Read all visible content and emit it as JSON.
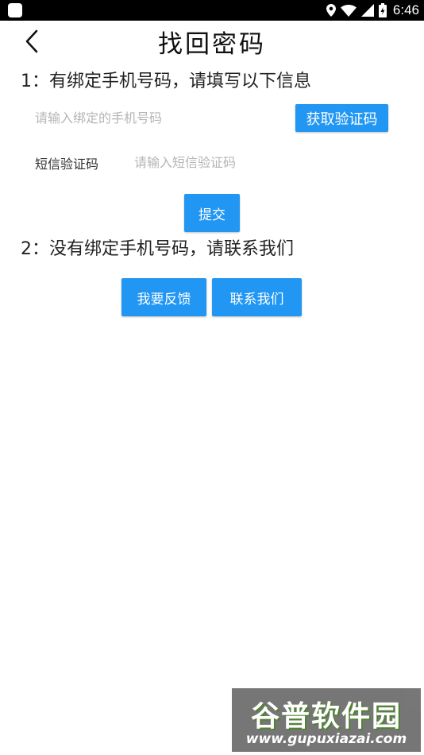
{
  "status_bar": {
    "time": "6:46",
    "icons": [
      "app-icon",
      "location-icon",
      "wifi-icon",
      "signal-icon",
      "battery-icon"
    ]
  },
  "header": {
    "back_icon": "chevron-left-icon",
    "title": "找回密码"
  },
  "section1": {
    "heading": "1：有绑定手机号码，请填写以下信息",
    "phone_placeholder": "请输入绑定的手机号码",
    "get_code_label": "获取验证码",
    "sms_label": "短信验证码",
    "sms_placeholder": "请输入短信验证码",
    "submit_label": "提交"
  },
  "section2": {
    "heading": "2：没有绑定手机号码，请联系我们",
    "feedback_label": "我要反馈",
    "contact_label": "联系我们"
  },
  "watermark": {
    "title": "谷普软件园",
    "url": "www.gupuxiazai.com"
  },
  "colors": {
    "accent": "#2196F3",
    "status_bar": "#000000",
    "placeholder": "#b5b5b5"
  }
}
